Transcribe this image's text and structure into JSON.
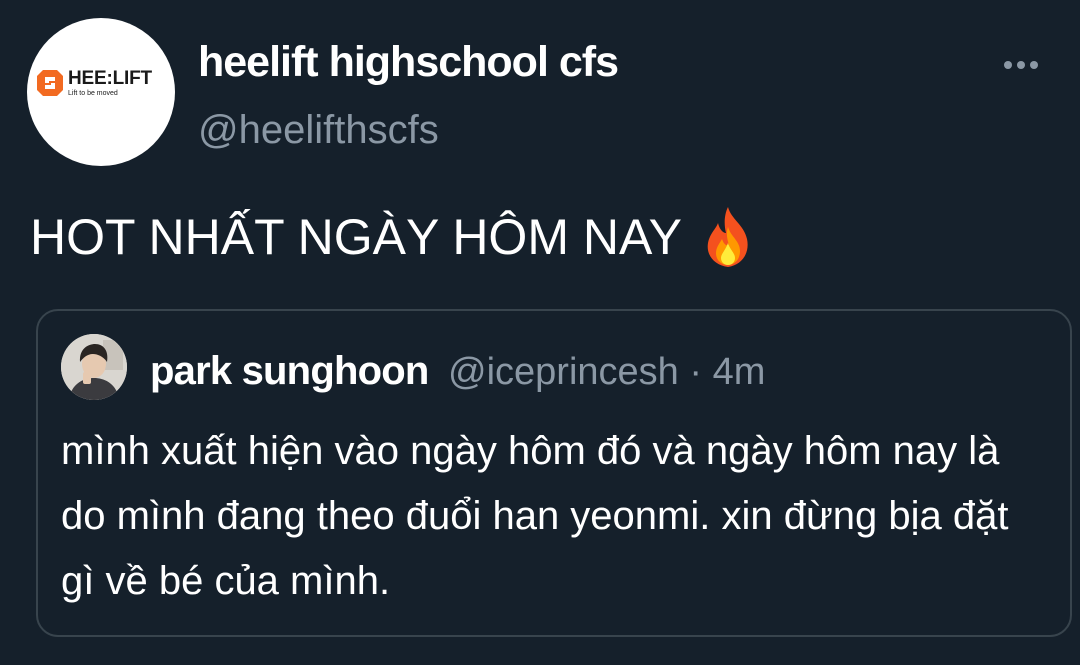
{
  "tweet": {
    "avatar": {
      "logo_word": "HEE:LIFT",
      "logo_tagline": "Lift to be moved",
      "brand_color": "#f26a21"
    },
    "display_name": "heelift highschool cfs",
    "handle": "@heelifthscfs",
    "more_icon": "more-horizontal-icon",
    "text": "HOT NHẤT NGÀY HÔM NAY",
    "emoji": "fire-icon"
  },
  "quote": {
    "display_name": "park sunghoon",
    "handle": "@iceprincesh",
    "separator": "·",
    "time": "4m",
    "body": "mình xuất hiện vào ngày hôm đó và ngày hôm nay là do mình đang theo đuổi han yeonmi. xin đừng bịa đặt gì về bé của mình."
  },
  "colors": {
    "background": "#15202b",
    "secondary_text": "#8b98a5",
    "border": "#38444d"
  }
}
